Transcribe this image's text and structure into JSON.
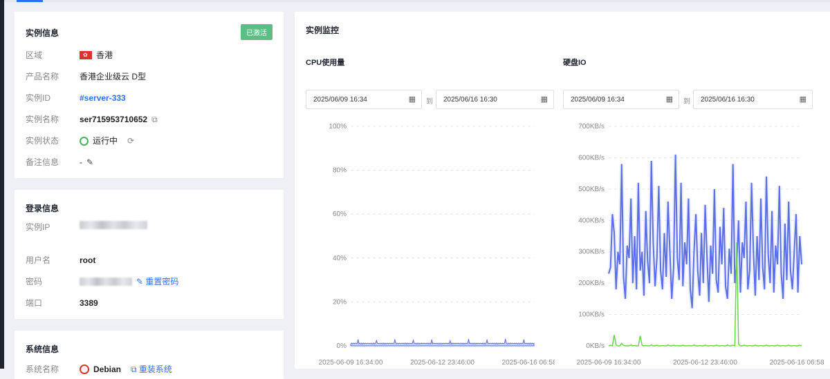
{
  "instance_info": {
    "title": "实例信息",
    "badge": "已激活",
    "rows": [
      {
        "label": "区域",
        "value": "香港"
      },
      {
        "label": "产品名称",
        "value": "香港企业级云 D型"
      },
      {
        "label": "实例ID",
        "value": "#server-333"
      },
      {
        "label": "实例名称",
        "value": "ser715953710652"
      },
      {
        "label": "实例状态",
        "value": "运行中"
      },
      {
        "label": "备注信息",
        "value": "-"
      }
    ]
  },
  "login_info": {
    "title": "登录信息",
    "rows": [
      {
        "label": "实例IP"
      },
      {
        "label": "用户名",
        "value": "root"
      },
      {
        "label": "密码",
        "action": "重置密码"
      },
      {
        "label": "端口",
        "value": "3389"
      }
    ]
  },
  "system_info": {
    "title": "系统信息",
    "label": "系统名称",
    "value": "Debian",
    "action": "重装系统"
  },
  "monitor": {
    "title": "实例监控",
    "cpu": {
      "title": "CPU使用量",
      "date_from": "2025/06/09 16:34",
      "date_to": "2025/06/16 16:30",
      "sep": "到"
    },
    "disk": {
      "title": "硬盘IO",
      "date_from": "2025/06/09 16:34",
      "date_to": "2025/06/16 16:30",
      "sep": "到"
    }
  },
  "chart_data": [
    {
      "type": "area",
      "y_ticks": [
        "0%",
        "20%",
        "40%",
        "60%",
        "80%",
        "100%"
      ],
      "x_ticks": [
        "2025-06-09 16:34:00",
        "2025-06-12 23:46:00",
        "2025-06-16 06:58:00"
      ],
      "ylim": [
        0,
        100
      ],
      "series": [
        {
          "color": "#5a6fe6",
          "base": 0.8,
          "spike_values": [
            3,
            2.5,
            2.8,
            2.6,
            2.9,
            2.4,
            3.1,
            2.7,
            3.2,
            2.9
          ]
        }
      ],
      "grid": true
    },
    {
      "type": "line",
      "y_ticks": [
        "0KB/s",
        "100KB/s",
        "200KB/s",
        "300KB/s",
        "400KB/s",
        "500KB/s",
        "600KB/s",
        "700KB/s"
      ],
      "x_ticks": [
        "2025-06-09 16:34:00",
        "2025-06-12 23:46:00",
        "2025-06-16 06:58:00"
      ],
      "ylim": [
        0,
        700
      ],
      "series": [
        {
          "color": "#5a6fe6",
          "values": [
            230,
            250,
            420,
            360,
            180,
            300,
            260,
            580,
            220,
            150,
            320,
            280,
            470,
            200,
            350,
            180,
            520,
            240,
            300,
            160,
            430,
            270,
            200,
            590,
            330,
            190,
            280,
            510,
            240,
            180,
            360,
            220,
            460,
            300,
            150,
            250,
            610,
            280,
            210,
            520,
            190,
            330,
            260,
            470,
            180,
            120,
            300,
            420,
            240,
            160,
            360,
            200,
            450,
            280,
            140,
            320,
            230,
            500,
            210,
            170,
            380,
            260,
            440,
            190,
            150,
            310,
            230,
            580,
            200,
            260,
            400,
            170,
            330,
            280,
            460,
            180,
            240,
            520,
            300,
            160,
            350,
            210,
            470,
            250,
            180,
            540,
            290,
            200,
            430,
            170,
            320,
            260,
            510,
            230,
            150,
            390,
            210,
            460,
            240,
            180,
            300,
            420,
            170,
            350,
            260
          ]
        },
        {
          "color": "#6cd24b",
          "values": [
            0,
            2,
            0,
            35,
            3,
            0,
            0,
            8,
            2,
            0,
            0,
            0,
            3,
            0,
            1,
            0,
            0,
            32,
            2,
            0,
            1,
            0,
            0,
            3,
            0,
            0,
            2,
            0,
            0,
            1,
            0,
            0,
            3,
            0,
            0,
            2,
            0,
            1,
            0,
            0,
            2,
            0,
            0,
            1,
            0,
            0,
            3,
            0,
            0,
            1,
            0,
            0,
            2,
            0,
            0,
            1,
            0,
            0,
            2,
            0,
            0,
            1,
            0,
            0,
            3,
            0,
            0,
            2,
            0,
            330,
            5,
            0,
            0,
            2,
            0,
            0,
            1,
            0,
            0,
            2,
            0,
            0,
            1,
            0,
            0,
            2,
            0,
            0,
            1,
            0,
            0,
            2,
            0,
            0,
            1,
            0,
            0,
            2,
            0,
            0,
            1,
            0,
            0,
            2,
            0
          ]
        }
      ],
      "grid": true
    }
  ]
}
